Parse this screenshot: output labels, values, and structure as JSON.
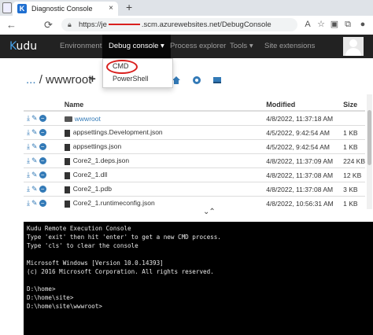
{
  "browser": {
    "tab_title": "Diagnostic Console",
    "tab_close": "×",
    "new_tab": "+",
    "url": ".scm.azurewebsites.net/DebugConsole",
    "url_prefix": "https://je",
    "nav": {
      "back": "←",
      "refresh": "⟳"
    },
    "icons": [
      "a-read-aloud-icon",
      "star-icon",
      "collections-icon",
      "extensions-icon",
      "profile-icon"
    ]
  },
  "navbar": {
    "brand_k": "K",
    "brand_rest": "udu",
    "items": [
      {
        "label": "Environment"
      },
      {
        "label": "Debug console ▾"
      },
      {
        "label": "Process explorer"
      },
      {
        "label": "Tools ▾"
      },
      {
        "label": "Site extensions"
      }
    ]
  },
  "dropdown": {
    "options": [
      "CMD",
      "PowerShell"
    ]
  },
  "path": {
    "dots": "...",
    "sep": "/",
    "folder": "wwwroot",
    "add": "+"
  },
  "table": {
    "headers": [
      "Name",
      "Modified",
      "Size"
    ],
    "rows": [
      {
        "name": "wwwroot",
        "modified": "4/8/2022, 11:37:18 AM",
        "size": "",
        "type": "folder"
      },
      {
        "name": "appsettings.Development.json",
        "modified": "4/5/2022, 9:42:54 AM",
        "size": "1 KB",
        "type": "file"
      },
      {
        "name": "appsettings.json",
        "modified": "4/5/2022, 9:42:54 AM",
        "size": "1 KB",
        "type": "file"
      },
      {
        "name": "Core2_1.deps.json",
        "modified": "4/8/2022, 11:37:09 AM",
        "size": "224 KB",
        "type": "file"
      },
      {
        "name": "Core2_1.dll",
        "modified": "4/8/2022, 11:37:08 AM",
        "size": "12 KB",
        "type": "file"
      },
      {
        "name": "Core2_1.pdb",
        "modified": "4/8/2022, 11:37:08 AM",
        "size": "3 KB",
        "type": "file"
      },
      {
        "name": "Core2_1.runtimeconfig.json",
        "modified": "4/8/2022, 10:56:31 AM",
        "size": "1 KB",
        "type": "file"
      }
    ]
  },
  "splitter": "⌄⌃",
  "console": {
    "lines": [
      "Kudu Remote Execution Console",
      "Type 'exit' then hit 'enter' to get a new CMD process.",
      "Type 'cls' to clear the console",
      "",
      "Microsoft Windows [Version 10.0.14393]",
      "(c) 2016 Microsoft Corporation. All rights reserved.",
      "",
      "D:\\home>",
      "D:\\home\\site>",
      "D:\\home\\site\\wwwroot>"
    ]
  },
  "colors": {
    "navbar_bg": "#222222",
    "link": "#337ab7",
    "highlight_circle": "#d9201e",
    "console_bg": "#000000"
  }
}
